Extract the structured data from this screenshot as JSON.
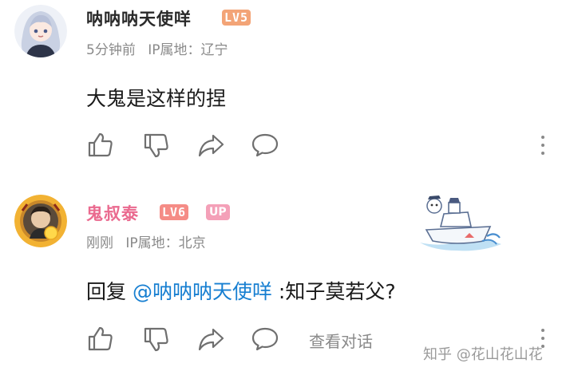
{
  "comments": [
    {
      "username": "呐呐呐天使咩",
      "level": "LV5",
      "time": "5分钟前",
      "ip": "IP属地：辽宁",
      "content": "大鬼是这样的捏"
    },
    {
      "username": "鬼叔泰",
      "level": "LV6",
      "badge": "UP",
      "time": "刚刚",
      "ip": "IP属地：北京",
      "reply_prefix": "回复 ",
      "mention": "@呐呐呐天使咩",
      "content": " :知子莫若父?",
      "view_thread": "查看对话"
    }
  ],
  "watermark": "知乎 @花山花山花",
  "colors": {
    "lv5_badge": "#f3a477",
    "lv6_badge": "#f58c86",
    "up_badge": "#f4a0b8",
    "up_name": "#ea6a8f",
    "mention": "#177fd1",
    "icon": "#6f6f6f"
  },
  "icons": [
    "like-icon",
    "dislike-icon",
    "share-icon",
    "reply-icon",
    "more-icon"
  ]
}
